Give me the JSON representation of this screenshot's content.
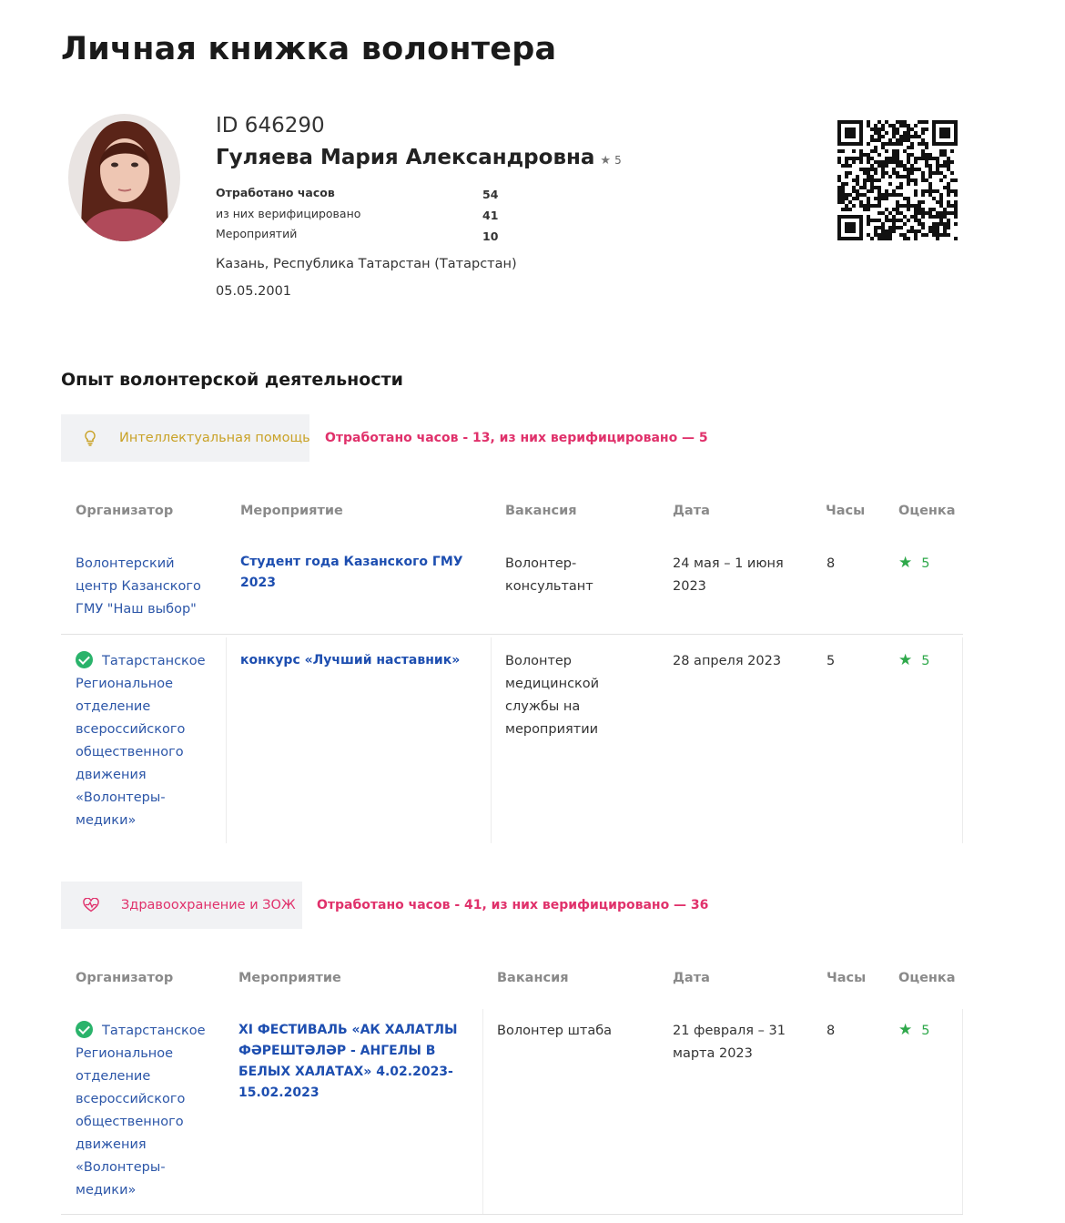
{
  "page": {
    "title": "Личная книжка волонтера"
  },
  "profile": {
    "id": "ID 646290",
    "name": "Гуляева Мария Александровна",
    "rating": "5",
    "stats": [
      {
        "label": "Отработано часов",
        "value": "54"
      },
      {
        "label": "из них верифицировано",
        "value": "41"
      },
      {
        "label": "Мероприятий",
        "value": "10"
      }
    ],
    "city": "Казань, Республика Татарстан (Татарстан)",
    "birthdate": "05.05.2001"
  },
  "experience": {
    "title": "Опыт волонтерской деятельности",
    "columns": {
      "organizer": "Организатор",
      "event": "Мероприятие",
      "vacancy": "Вакансия",
      "date": "Дата",
      "hours": "Часы",
      "grade": "Оценка"
    },
    "categories": [
      {
        "label": "Интеллектуальная помощь",
        "icon": "lightbulb-icon",
        "color": "#c9a227",
        "stats": "Отработано часов - 13, из них верифицировано — 5",
        "rows": [
          {
            "organizer": "Волонтерский центр Казанского ГМУ \"Наш выбор\"",
            "verified": false,
            "event": "Студент года Казанского ГМУ 2023",
            "vacancy": "Волонтер-консультант",
            "date": "24 мая – 1 июня 2023",
            "hours": "8",
            "grade": "5"
          },
          {
            "organizer": "Татарстанское Региональное отделение всероссийского общественного движения «Волонтеры-медики»",
            "verified": true,
            "event": "конкурс «Лучший наставник»",
            "vacancy": "Волонтер медицинской службы на мероприятии",
            "date": "28 апреля 2023",
            "hours": "5",
            "grade": "5"
          }
        ]
      },
      {
        "label": "Здравоохранение и ЗОЖ",
        "icon": "heart-pulse-icon",
        "color": "#e0316b",
        "stats": "Отработано часов - 41, из них верифицировано — 36",
        "rows": [
          {
            "organizer": "Татарстанское Региональное отделение всероссийского общественного движения «Волонтеры-медики»",
            "verified": true,
            "event": "XI ФЕСТИВАЛЬ «АК ХАЛАТЛЫ ФӘРЕШТӘЛӘР - АНГЕЛЫ В БЕЛЫХ ХАЛАТАХ» 4.02.2023- 15.02.2023",
            "vacancy": "Волонтер штаба",
            "date": "21 февраля – 31 марта 2023",
            "hours": "8",
            "grade": "5"
          }
        ]
      }
    ]
  },
  "colors": {
    "accent_pink": "#e0316b",
    "link_blue": "#2c56a8",
    "verified_green": "#2ab36b",
    "grade_green": "#2ea84a"
  }
}
